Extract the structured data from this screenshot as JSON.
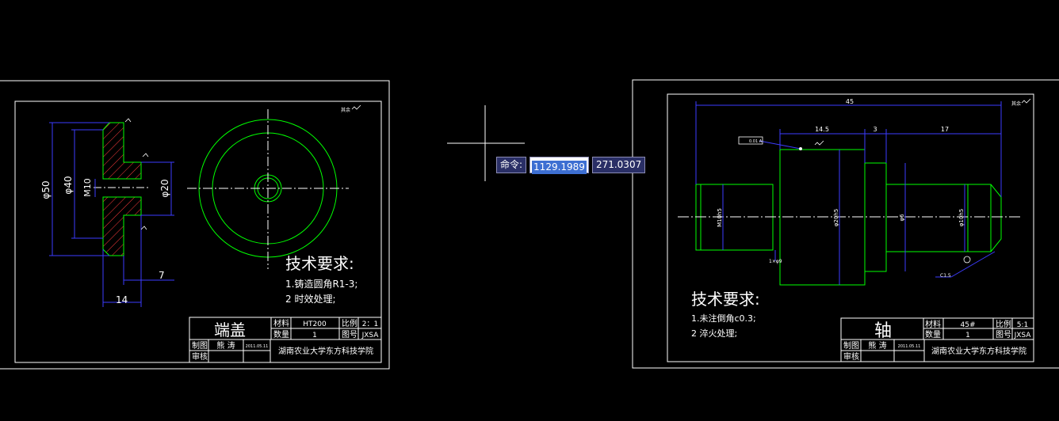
{
  "colors": {
    "background": "#000000",
    "frame": "#ffffff",
    "outline": "#00ff00",
    "dimension": "#3c3cff",
    "text": "#ffffff"
  },
  "left_drawing": {
    "part_name": "端盖",
    "material_label": "材料",
    "material": "HT200",
    "scale_label": "比例",
    "scale": "2：1",
    "quantity_label": "数量",
    "quantity": "1",
    "drawing_no_label": "图号",
    "drawing_no": "JXSA",
    "drawn_by_label": "制图",
    "drawn_by": "熊 涛",
    "date": "2011.05.11",
    "checked_label": "审核",
    "school": "湖南农业大学东方科技学院",
    "tech_title": "技术要求:",
    "tech_note_1": "1.铸造圆角R1-3;",
    "tech_note_2": "2 时效处理;",
    "dims": {
      "d50": "φ50",
      "d40": "φ40",
      "m10": "M10",
      "d20": "φ20",
      "len7": "7",
      "len14": "14"
    },
    "roughness_note": "其余"
  },
  "right_drawing": {
    "part_name": "轴",
    "material_label": "材料",
    "material": "45#",
    "scale_label": "比例",
    "scale": "5:1",
    "quantity_label": "数量",
    "quantity": "1",
    "drawing_no_label": "图号",
    "drawing_no": "JXSA",
    "drawn_by_label": "制图",
    "drawn_by": "熊 涛",
    "date": "2011.05.11",
    "checked_label": "审核",
    "school": "湖南农业大学东方科技学院",
    "tech_title": "技术要求:",
    "tech_note_1": "1.未注倒角c0.3;",
    "tech_note_2": "2 淬火处理;",
    "dims": {
      "overall": "45",
      "seg1": "14.5",
      "seg2": "3",
      "seg3": "17",
      "thread": "M10h5",
      "dmid": "φ20h5",
      "d6": "φ6",
      "d10": "φ10h5",
      "chamfer": "1×φ9",
      "c15": "C1.5",
      "tol": "0.01 A"
    },
    "roughness_note": "其余"
  },
  "command_line": {
    "label": "命令:",
    "x_value": "1129.1989",
    "y_value": "271.0307"
  }
}
